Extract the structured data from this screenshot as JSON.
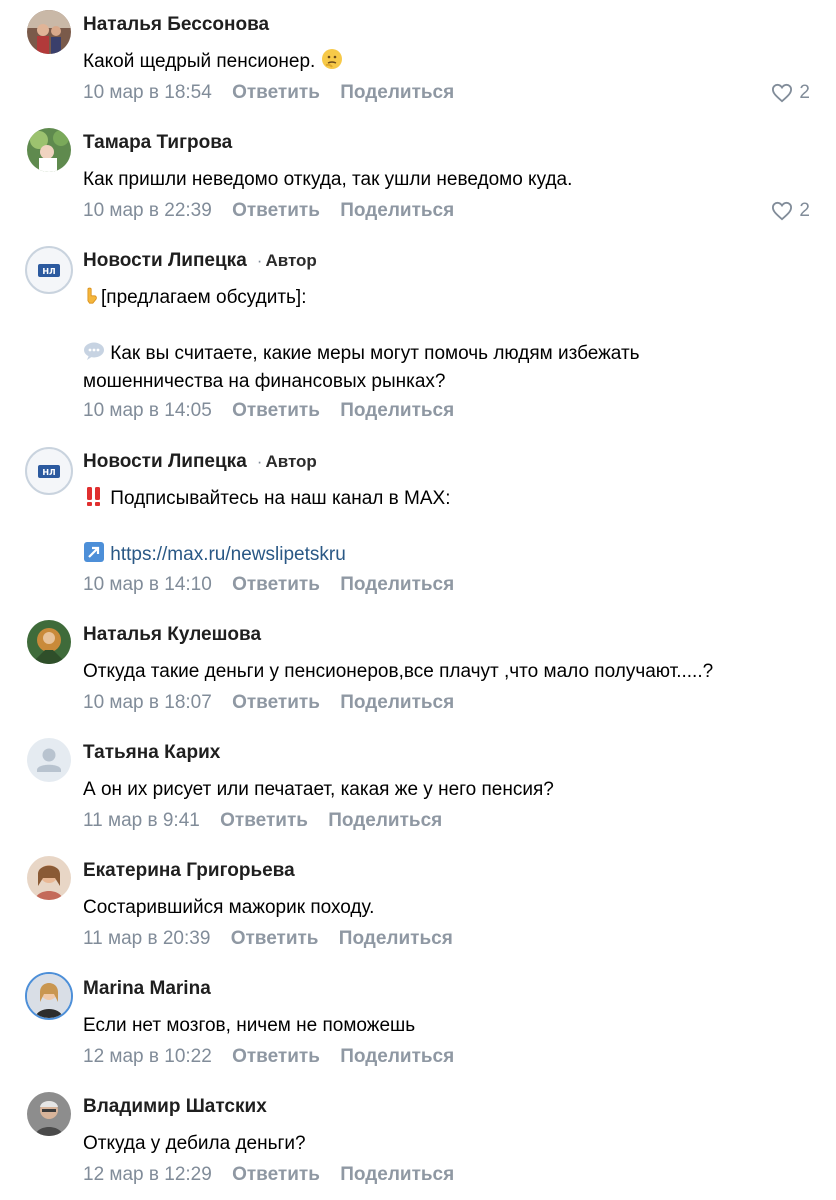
{
  "comments": [
    {
      "author": "Наталья Бессонова",
      "text": "Какой щедрый пенсионер.",
      "date": "10 мар в 18:54",
      "reply": "Ответить",
      "share": "Поделиться",
      "likes": "2"
    },
    {
      "author": "Тамара Тигрова",
      "text": "Как пришли неведомо откуда, так ушли неведомо куда.",
      "date": "10 мар в 22:39",
      "reply": "Ответить",
      "share": "Поделиться",
      "likes": "2"
    },
    {
      "author": "Новости Липецка",
      "badge": "Автор",
      "line1": "[предлагаем обсудить]:",
      "line2": "Как вы считаете, какие меры могут помочь людям избежать",
      "line3": "мошенничества на финансовых рынках?",
      "date": "10 мар в 14:05",
      "reply": "Ответить",
      "share": "Поделиться",
      "avatar_text": "НЛ"
    },
    {
      "author": "Новости Липецка",
      "badge": "Автор",
      "line1": "Подписывайтесь на наш канал в MAX:",
      "link": "https://max.ru/newslipetskru",
      "date": "10 мар в 14:10",
      "reply": "Ответить",
      "share": "Поделиться",
      "avatar_text": "НЛ"
    },
    {
      "author": "Наталья Кулешова",
      "text": "Откуда такие деньги у пенсионеров,все плачут ,что мало получают.....?",
      "date": "10 мар в 18:07",
      "reply": "Ответить",
      "share": "Поделиться"
    },
    {
      "author": "Татьяна Карих",
      "text": "А он их рисует или печатает, какая же у него пенсия?",
      "date": "11 мар в 9:41",
      "reply": "Ответить",
      "share": "Поделиться"
    },
    {
      "author": "Екатерина Григорьева",
      "text": "Состарившийся мажорик походу.",
      "date": "11 мар в 20:39",
      "reply": "Ответить",
      "share": "Поделиться"
    },
    {
      "author": "Marina Marina",
      "text": "Если нет мозгов, ничем не поможешь",
      "date": "12 мар в 10:22",
      "reply": "Ответить",
      "share": "Поделиться"
    },
    {
      "author": "Владимир Шатских",
      "text": "Откуда у дебила деньги?",
      "date": "12 мар в 12:29",
      "reply": "Ответить",
      "share": "Поделиться"
    }
  ],
  "icons": {
    "like": "heart-outline-icon",
    "speech": "speech-bubble-icon",
    "point": "pointing-hand-icon",
    "alert": "double-exclamation-icon",
    "link": "arrow-up-right-icon",
    "think": "thinking-face-icon"
  },
  "colors": {
    "meta": "#818c99",
    "link": "#2a5885",
    "brand": "#2c5a9f"
  }
}
